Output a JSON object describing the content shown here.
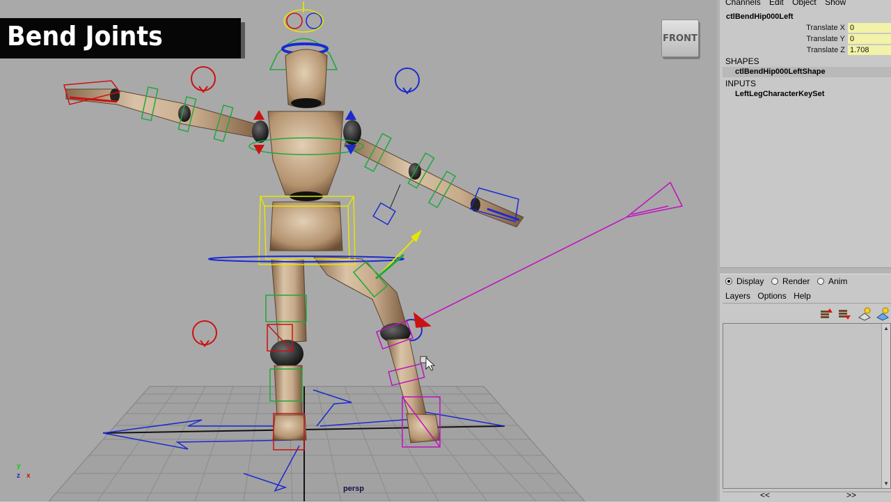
{
  "title": "Bend Joints",
  "viewcube_label": "FRONT",
  "camera_label": "persp",
  "axis": {
    "x": "x",
    "y": "y",
    "z": "z"
  },
  "channel_box": {
    "menu": [
      "Channels",
      "Edit",
      "Object",
      "Show"
    ],
    "node": "ctlBendHip000Left",
    "attributes": [
      {
        "name": "Translate X",
        "value": "0"
      },
      {
        "name": "Translate Y",
        "value": "0"
      },
      {
        "name": "Translate Z",
        "value": "1.708"
      }
    ],
    "shapes_header": "SHAPES",
    "shape": "ctlBendHip000LeftShape",
    "inputs_header": "INPUTS",
    "input": "LeftLegCharacterKeySet"
  },
  "layer_editor": {
    "modes": [
      {
        "label": "Display",
        "selected": true
      },
      {
        "label": "Render",
        "selected": false
      },
      {
        "label": "Anim",
        "selected": false
      }
    ],
    "menu": [
      "Layers",
      "Options",
      "Help"
    ],
    "pager_prev": "<<",
    "pager_next": ">>"
  },
  "colors": {
    "viewport_bg": "#a9a9a9",
    "attr_highlight": "#f2f2a8",
    "control_red": "#cc1111",
    "control_blue": "#1a2ad0",
    "control_green": "#1fa83a",
    "control_yellow": "#e6e600",
    "control_magenta": "#c010c0"
  }
}
